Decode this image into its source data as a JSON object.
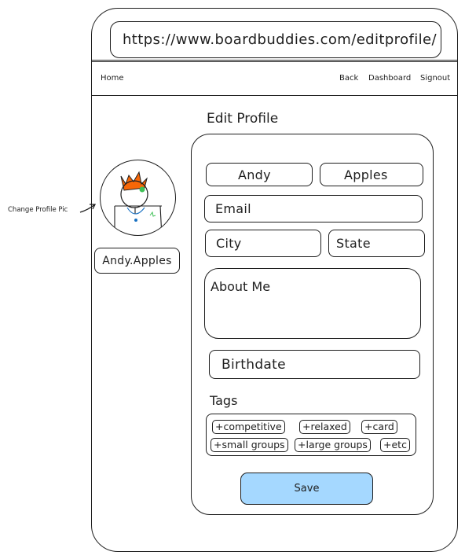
{
  "browser": {
    "url": "https://www.boardbuddies.com/editprofile/"
  },
  "nav": {
    "home": "Home",
    "back": "Back",
    "dashboard": "Dashboard",
    "signout": "Signout"
  },
  "page": {
    "title": "Edit Profile"
  },
  "profile": {
    "annotation": "Change Profile Pic",
    "username": "Andy.Apples",
    "first_name": "Andy",
    "last_name": "Apples"
  },
  "form": {
    "email_placeholder": "Email",
    "city_placeholder": "City",
    "state_placeholder": "State",
    "about_placeholder": "About Me",
    "birthdate_placeholder": "Birthdate",
    "tags_label": "Tags",
    "tags": [
      "+competitive",
      "+relaxed",
      "+card",
      "+small groups",
      "+large groups",
      "+etc"
    ],
    "save_label": "Save"
  },
  "colors": {
    "save_button": "#a5d8ff",
    "crown": "#f76707",
    "eye": "#40c057",
    "necklace": "#1971c2"
  }
}
